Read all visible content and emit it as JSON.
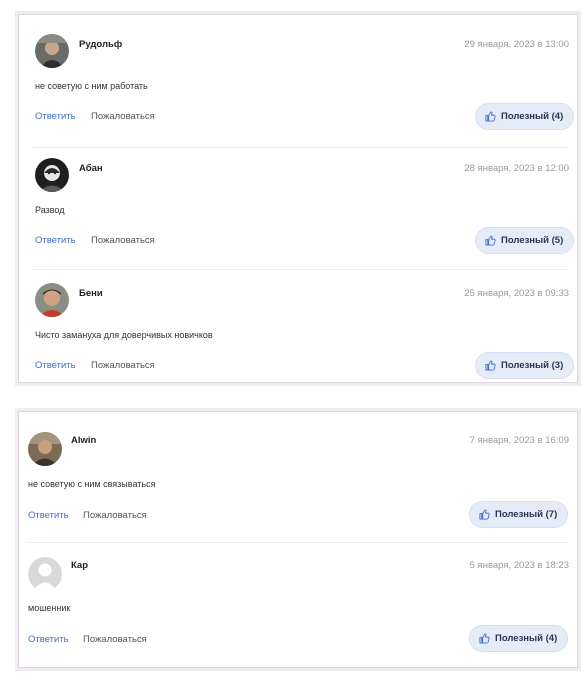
{
  "panel1": {
    "comments": [
      {
        "author": "Рудольф",
        "date": "29 января, 2023 в 13:00",
        "text": "не советую с ним работать",
        "reply": "Ответить",
        "report": "Пожаловаться",
        "useful": "Полезный (4)"
      },
      {
        "author": "Абан",
        "date": "28 января, 2023 в 12:00",
        "text": "Развод",
        "reply": "Ответить",
        "report": "Пожаловаться",
        "useful": "Полезный (5)"
      },
      {
        "author": "Бени",
        "date": "25 января, 2023 в 09:33",
        "text": "Чисто замануха для доверчивых новичков",
        "reply": "Ответить",
        "report": "Пожаловаться",
        "useful": "Полезный (3)"
      }
    ]
  },
  "panel2": {
    "comments": [
      {
        "author": "Alwin",
        "date": "7 января, 2023 в 16:09",
        "text": "не советую с ним связываться",
        "reply": "Ответить",
        "report": "Пожаловаться",
        "useful": "Полезный (7)"
      },
      {
        "author": "Кар",
        "date": "5 января, 2023 в 18:23",
        "text": "мошенник",
        "reply": "Ответить",
        "report": "Пожаловаться",
        "useful": "Полезный (4)"
      }
    ]
  },
  "icons": {
    "useful": "thumbs-up-icon",
    "avatar_default": "user-silhouette-icon"
  },
  "colors": {
    "accent_link": "#3f6fd2",
    "useful_bg": "#e6ebf8",
    "date": "#9a9a9a"
  }
}
